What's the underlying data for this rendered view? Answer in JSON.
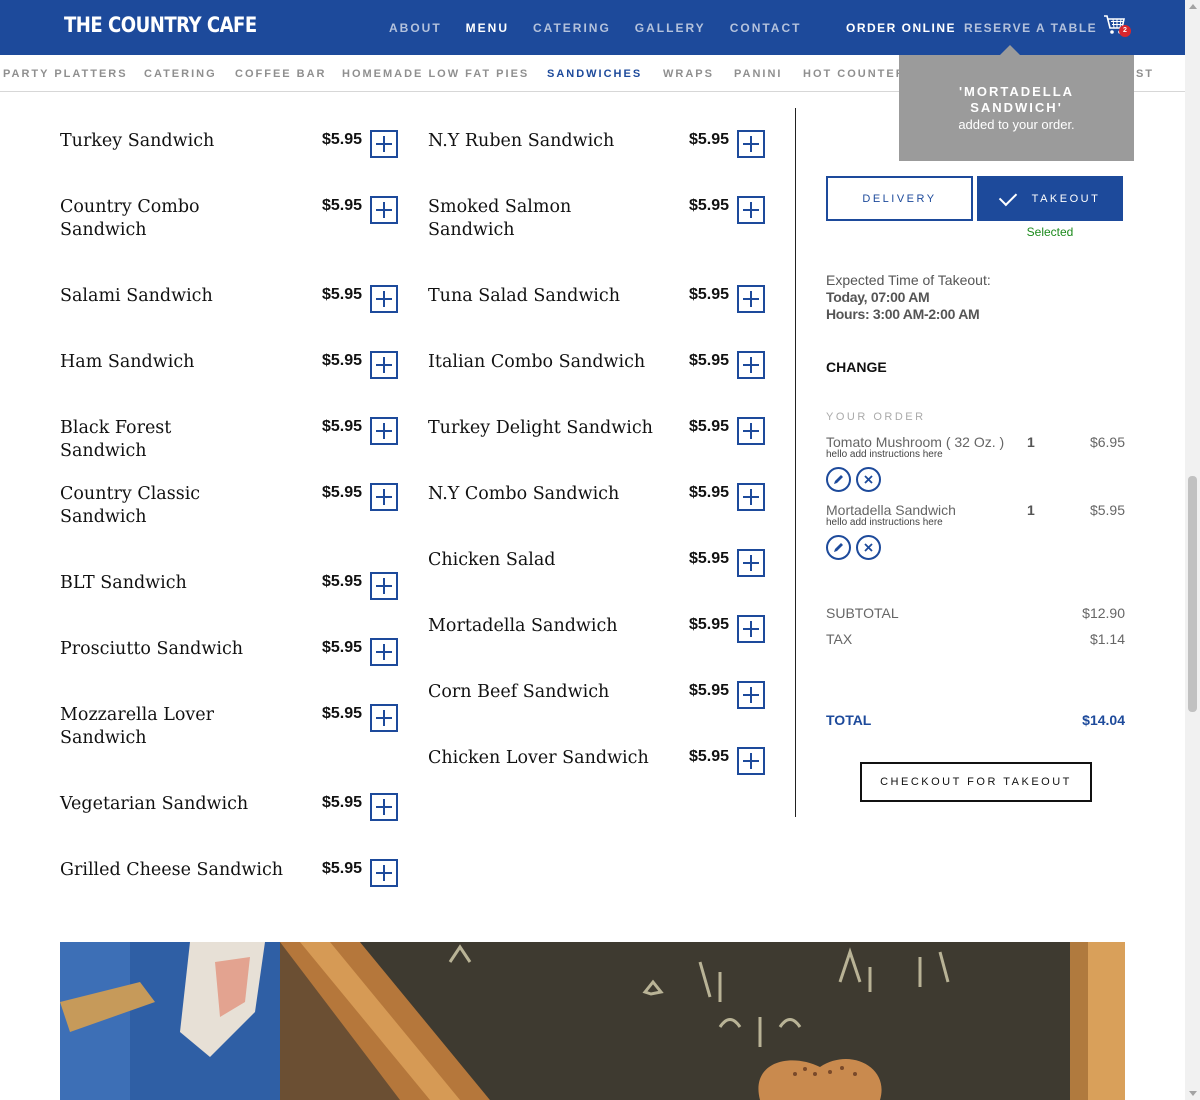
{
  "header": {
    "logo": "THE COUNTRY CAFE",
    "nav": [
      {
        "label": "ABOUT",
        "active": false
      },
      {
        "label": "MENU",
        "active": true
      },
      {
        "label": "CATERING",
        "active": false
      },
      {
        "label": "GALLERY",
        "active": false
      },
      {
        "label": "CONTACT",
        "active": false
      }
    ],
    "order_online": "ORDER ONLINE",
    "reserve": "RESERVE A TABLE",
    "cart_count": "2"
  },
  "categories": [
    {
      "label": "PARTY PLATTERS",
      "active": false
    },
    {
      "label": "CATERING",
      "active": false
    },
    {
      "label": "COFFEE BAR",
      "active": false
    },
    {
      "label": "HOMEMADE LOW FAT PIES",
      "active": false
    },
    {
      "label": "SANDWICHES",
      "active": true
    },
    {
      "label": "WRAPS",
      "active": false
    },
    {
      "label": "PANINI",
      "active": false
    },
    {
      "label": "HOT COUNTER",
      "active": false
    },
    {
      "label": "AST",
      "active": false
    }
  ],
  "menu": {
    "left": [
      {
        "name": "Turkey Sandwich",
        "price": "$5.95"
      },
      {
        "name": "Country Combo Sandwich",
        "price": "$5.95"
      },
      {
        "name": "Salami Sandwich",
        "price": "$5.95"
      },
      {
        "name": "Ham Sandwich",
        "price": "$5.95"
      },
      {
        "name": "Black Forest Sandwich",
        "price": "$5.95"
      },
      {
        "name": "Country Classic Sandwich",
        "price": "$5.95"
      },
      {
        "name": "BLT Sandwich",
        "price": "$5.95"
      },
      {
        "name": "Prosciutto Sandwich",
        "price": "$5.95"
      },
      {
        "name": "Mozzarella Lover Sandwich",
        "price": "$5.95"
      },
      {
        "name": "Vegetarian Sandwich",
        "price": "$5.95"
      },
      {
        "name": "Grilled Cheese Sandwich",
        "price": "$5.95"
      }
    ],
    "right": [
      {
        "name": "N.Y Ruben Sandwich",
        "price": "$5.95"
      },
      {
        "name": "Smoked Salmon Sandwich",
        "price": "$5.95"
      },
      {
        "name": "Tuna Salad Sandwich",
        "price": "$5.95"
      },
      {
        "name": "Italian Combo Sandwich",
        "price": "$5.95"
      },
      {
        "name": "Turkey Delight Sandwich",
        "price": "$5.95"
      },
      {
        "name": "N.Y Combo Sandwich",
        "price": "$5.95"
      },
      {
        "name": "Chicken Salad",
        "price": "$5.95"
      },
      {
        "name": "Mortadella Sandwich",
        "price": "$5.95"
      },
      {
        "name": "Corn Beef Sandwich",
        "price": "$5.95"
      },
      {
        "name": "Chicken Lover Sandwich",
        "price": "$5.95"
      }
    ]
  },
  "toast": {
    "title": "'MORTADELLA SANDWICH'",
    "message": "added to your order."
  },
  "order_panel": {
    "delivery_label": "DELIVERY",
    "takeout_label": "TAKEOUT",
    "selected_label": "Selected",
    "expected_label": "Expected Time of Takeout:",
    "expected_time": "Today, 07:00 AM",
    "hours": "Hours: 3:00 AM-2:00 AM",
    "change_label": "CHANGE",
    "your_order_label": "YOUR ORDER",
    "items": [
      {
        "name": "Tomato Mushroom ( 32 Oz. )",
        "note": "hello add instructions here",
        "qty": "1",
        "price": "$6.95"
      },
      {
        "name": "Mortadella Sandwich",
        "note": "hello add instructions here",
        "qty": "1",
        "price": "$5.95"
      }
    ],
    "subtotal_label": "SUBTOTAL",
    "subtotal": "$12.90",
    "tax_label": "TAX",
    "tax": "$1.14",
    "total_label": "TOTAL",
    "total": "$14.04",
    "checkout_label": "CHECKOUT FOR TAKEOUT"
  },
  "colors": {
    "brand_blue": "#1d4a9b",
    "toast_gray": "#9b9b9b",
    "selected_green": "#1c8a1c"
  }
}
